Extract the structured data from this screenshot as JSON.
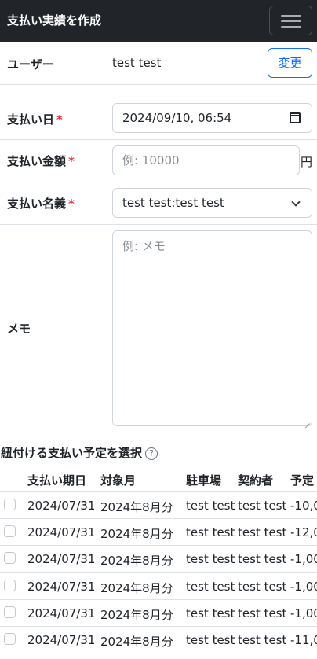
{
  "navbar": {
    "title": "支払い実績を作成",
    "menu_icon": "hamburger-menu-icon"
  },
  "user": {
    "label": "ユーザー",
    "value": "test test",
    "change_button": "変更"
  },
  "payment_date": {
    "label": "支払い日",
    "required_mark": "*",
    "value": "2024/09/10, 06:54",
    "icon": "calendar-icon"
  },
  "amount": {
    "label": "支払い金額",
    "required_mark": "*",
    "placeholder": "例: 10000",
    "unit": "円"
  },
  "payment_name": {
    "label": "支払い名義",
    "required_mark": "*",
    "selected": "test test:test test",
    "icon": "chevron-down-icon"
  },
  "memo": {
    "label": "メモ",
    "placeholder": "例: メモ"
  },
  "schedule": {
    "title": "紐付ける支払い予定を選択",
    "help_icon_glyph": "?",
    "headers": [
      "支払い期日",
      "対象月",
      "駐車場",
      "契約者",
      "予定"
    ],
    "rows": [
      [
        "2024/07/31",
        "2024年8月分",
        "test test",
        "test test",
        "-10,0"
      ],
      [
        "2024/07/31",
        "2024年8月分",
        "test test",
        "test test",
        "-12,0"
      ],
      [
        "2024/07/31",
        "2024年8月分",
        "test test",
        "test test",
        "-1,00"
      ],
      [
        "2024/07/31",
        "2024年8月分",
        "test test",
        "test test",
        "-1,00"
      ],
      [
        "2024/07/31",
        "2024年8月分",
        "test test",
        "test test",
        "-1,00"
      ],
      [
        "2024/07/31",
        "2024年8月分",
        "test test",
        "test test",
        "-11,0"
      ]
    ]
  },
  "colors": {
    "navbar_bg": "#212529",
    "primary": "#0d6efd",
    "required": "#dc3545",
    "border": "#dee2e6"
  }
}
